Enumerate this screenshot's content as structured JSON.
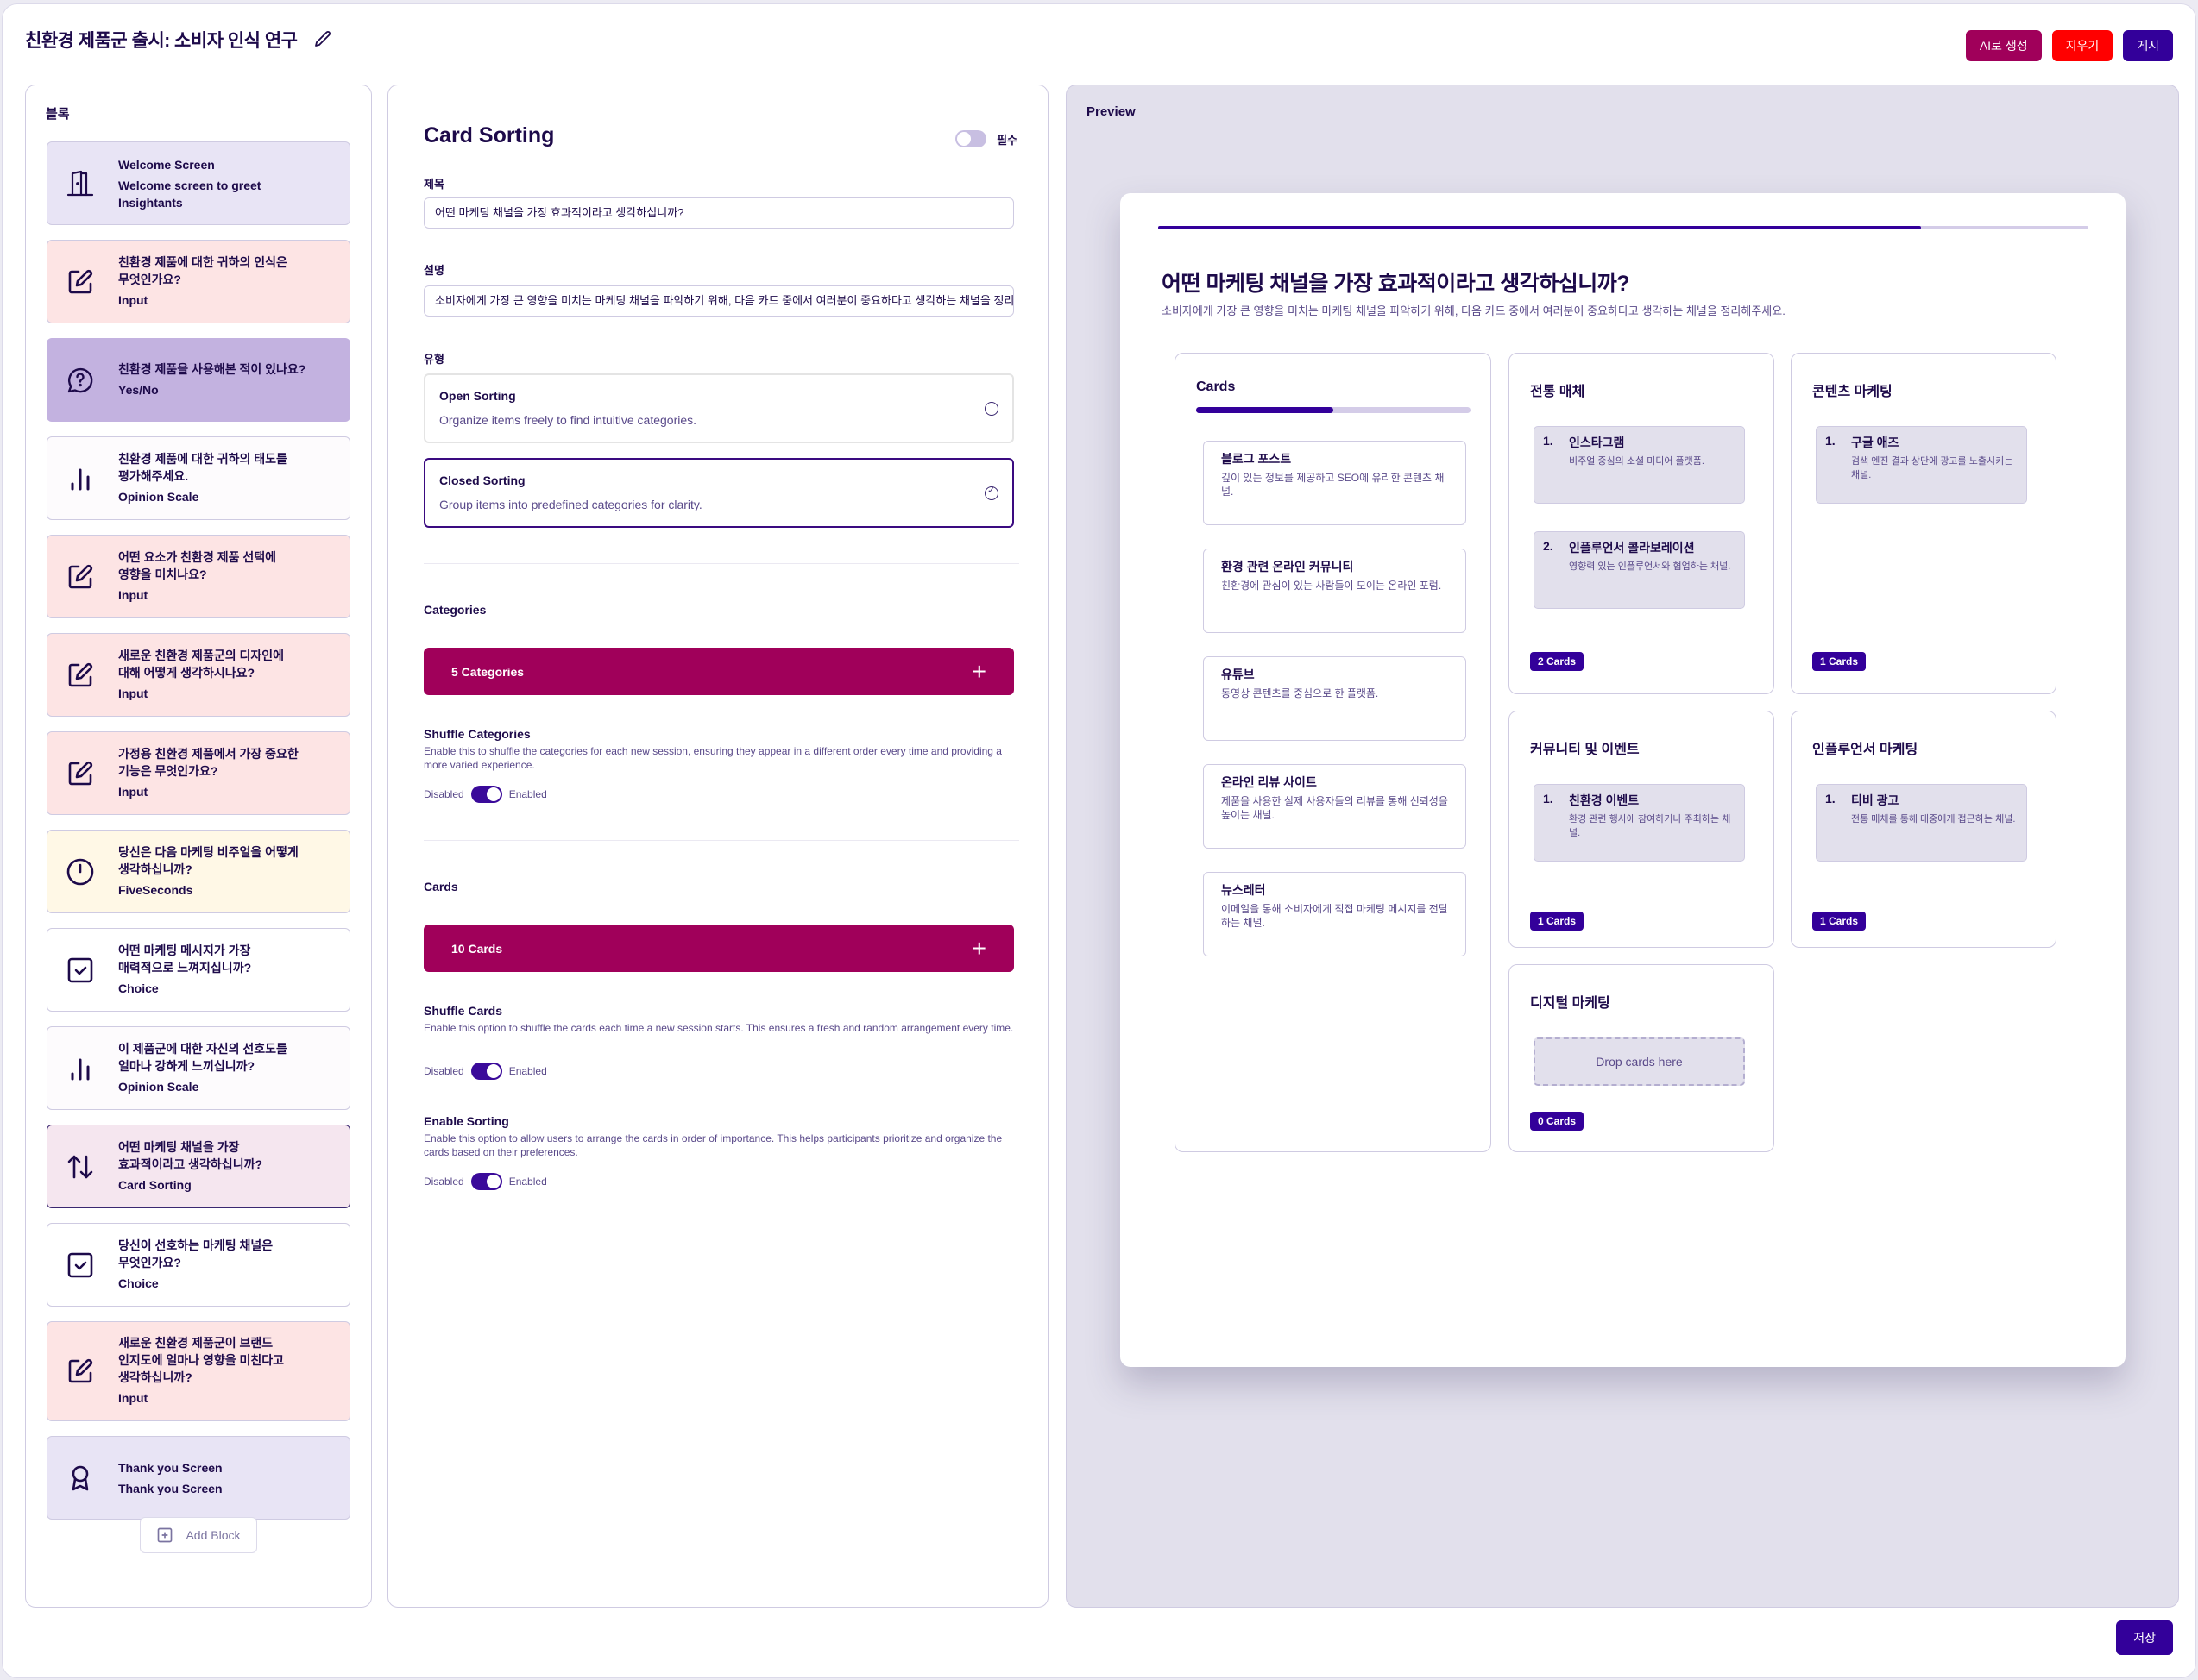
{
  "header": {
    "title": "친환경 제품군 출시: 소비자 인식 연구",
    "actions": {
      "ai_generate": "AI로 생성",
      "clear": "지우기",
      "publish": "게시"
    },
    "colors": {
      "ai_generate": "#a0005a",
      "clear": "#ff0000",
      "publish": "#33009a"
    }
  },
  "blocks": {
    "heading": "블록",
    "items": [
      {
        "title": "Welcome Screen",
        "type": "Welcome screen to greet\nInsightants",
        "icon": "door-icon",
        "variant": "welcome"
      },
      {
        "title": "친환경 제품에 대한 귀하의 인식은\n무엇인가요?",
        "type": "Input",
        "icon": "edit-icon",
        "variant": "input"
      },
      {
        "title": "친환경 제품을 사용해본 적이 있나요?",
        "type": "Yes/No",
        "icon": "question-bubble-icon",
        "variant": "yesno"
      },
      {
        "title": "친환경 제품에 대한 귀하의 태도를\n평가해주세요.",
        "type": "Opinion Scale",
        "icon": "bar-chart-icon",
        "variant": "opinion"
      },
      {
        "title": "어떤 요소가 친환경 제품 선택에\n영향을 미치나요?",
        "type": "Input",
        "icon": "edit-icon",
        "variant": "input"
      },
      {
        "title": "새로운 친환경 제품군의 디자인에\n대해 어떻게 생각하시나요?",
        "type": "Input",
        "icon": "edit-icon",
        "variant": "input"
      },
      {
        "title": "가정용 친환경 제품에서 가장 중요한\n기능은 무엇인가요?",
        "type": "Input",
        "icon": "edit-icon",
        "variant": "input"
      },
      {
        "title": "당신은 다음 마케팅 비주얼을 어떻게\n생각하십니까?",
        "type": "FiveSeconds",
        "icon": "timer-icon",
        "variant": "five"
      },
      {
        "title": "어떤 마케팅 메시지가 가장\n매력적으로 느껴지십니까?",
        "type": "Choice",
        "icon": "checkbox-icon",
        "variant": "choice"
      },
      {
        "title": "이 제품군에 대한 자신의 선호도를\n얼마나 강하게 느끼십니까?",
        "type": "Opinion Scale",
        "icon": "bar-chart-icon",
        "variant": "opinion"
      },
      {
        "title": "어떤 마케팅 채널을 가장\n효과적이라고 생각하십니까?",
        "type": "Card Sorting",
        "icon": "sort-arrows-icon",
        "variant": "card",
        "selected": true
      },
      {
        "title": "당신이 선호하는 마케팅 채널은\n무엇인가요?",
        "type": "Choice",
        "icon": "checkbox-icon",
        "variant": "choice"
      },
      {
        "title": "새로운 친환경 제품군이 브랜드\n인지도에 얼마나 영향을 미친다고\n생각하십니까?",
        "type": "Input",
        "icon": "edit-icon",
        "variant": "input"
      },
      {
        "title": "Thank you Screen",
        "type": "Thank you Screen",
        "icon": "award-icon",
        "variant": "thanks"
      }
    ],
    "add_block": "Add Block"
  },
  "editor": {
    "title": "Card Sorting",
    "required_label": "필수",
    "required": false,
    "title_label": "제목",
    "title_value": "어떤 마케팅 채널을 가장 효과적이라고 생각하십니까?",
    "description_label": "설명",
    "description_value": "소비자에게 가장 큰 영향을 미치는 마케팅 채널을 파악하기 위해, 다음 카드 중에서 여러분이 중요하다고 생각하는 채널을 정리해주세요.",
    "type_label": "유형",
    "types": [
      {
        "name": "Open Sorting",
        "desc": "Organize items freely to find intuitive categories.",
        "selected": false
      },
      {
        "name": "Closed Sorting",
        "desc": "Group items into predefined categories for clarity.",
        "selected": true
      }
    ],
    "categories_title": "Categories",
    "categories_count": "5 Categories",
    "shuffle_categories": {
      "title": "Shuffle Categories",
      "desc": "Enable this to shuffle the categories for each new session, ensuring they appear in a different order every time and providing a more varied experience.",
      "off_label": "Disabled",
      "on_label": "Enabled",
      "enabled": true
    },
    "cards_title": "Cards",
    "cards_count": "10 Cards",
    "shuffle_cards": {
      "title": "Shuffle Cards",
      "desc": "Enable this option to shuffle the cards each time a new session starts. This ensures a fresh and random arrangement every time.",
      "off_label": "Disabled",
      "on_label": "Enabled",
      "enabled": true
    },
    "enable_sorting": {
      "title": "Enable Sorting",
      "desc": "Enable this option to allow users to arrange the cards in order of importance. This helps participants prioritize and organize the cards based on their preferences.",
      "off_label": "Disabled",
      "on_label": "Enabled",
      "enabled": true
    }
  },
  "preview": {
    "heading": "Preview",
    "progress_fraction": 0.82,
    "title": "어떤 마케팅 채널을 가장 효과적이라고 생각하십니까?",
    "description": "소비자에게 가장 큰 영향을 미치는 마케팅 채널을 파악하기 위해, 다음 카드 중에서 여러분이 중요하다고 생각하는 채널을 정리해주세요.",
    "cards_heading": "Cards",
    "cards_progress_fraction": 0.5,
    "cards": [
      {
        "name": "블로그 포스트",
        "desc": "깊이 있는 정보를 제공하고 SEO에 유리한 콘텐츠 채널."
      },
      {
        "name": "환경 관련 온라인 커뮤니티",
        "desc": "친환경에 관심이 있는 사람들이 모이는 온라인 포럼."
      },
      {
        "name": "유튜브",
        "desc": "동영상 콘텐츠를 중심으로 한 플랫폼."
      },
      {
        "name": "온라인 리뷰 사이트",
        "desc": "제품을 사용한 실제 사용자들의 리뷰를 통해 신뢰성을 높이는 채널."
      },
      {
        "name": "뉴스레터",
        "desc": "이메일을 통해 소비자에게 직접 마케팅 메시지를 전달하는 채널."
      }
    ],
    "categories": [
      {
        "name": "전통 매체",
        "badge": "2 Cards",
        "cards": [
          {
            "num": "1.",
            "name": "인스타그램",
            "desc": "비주얼 중심의 소셜 미디어 플랫폼."
          },
          {
            "num": "2.",
            "name": "인플루언서 콜라보레이션",
            "desc": "영향력 있는 인플루언서와 협업하는 채널."
          }
        ]
      },
      {
        "name": "콘텐츠 마케팅",
        "badge": "1 Cards",
        "cards": [
          {
            "num": "1.",
            "name": "구글 애즈",
            "desc": "검색 엔진 결과 상단에 광고를 노출시키는 채널."
          }
        ]
      },
      {
        "name": "커뮤니티 및 이벤트",
        "badge": "1 Cards",
        "cards": [
          {
            "num": "1.",
            "name": "친환경 이벤트",
            "desc": "환경 관련 행사에 참여하거나 주최하는 채널."
          }
        ]
      },
      {
        "name": "인플루언서 마케팅",
        "badge": "1 Cards",
        "cards": [
          {
            "num": "1.",
            "name": "티비 광고",
            "desc": "전통 매체를 통해 대중에게 접근하는 채널."
          }
        ]
      },
      {
        "name": "디지털 마케팅",
        "badge": "0 Cards",
        "cards": [],
        "drop_text": "Drop cards here"
      }
    ]
  },
  "footer": {
    "save": "저장"
  }
}
